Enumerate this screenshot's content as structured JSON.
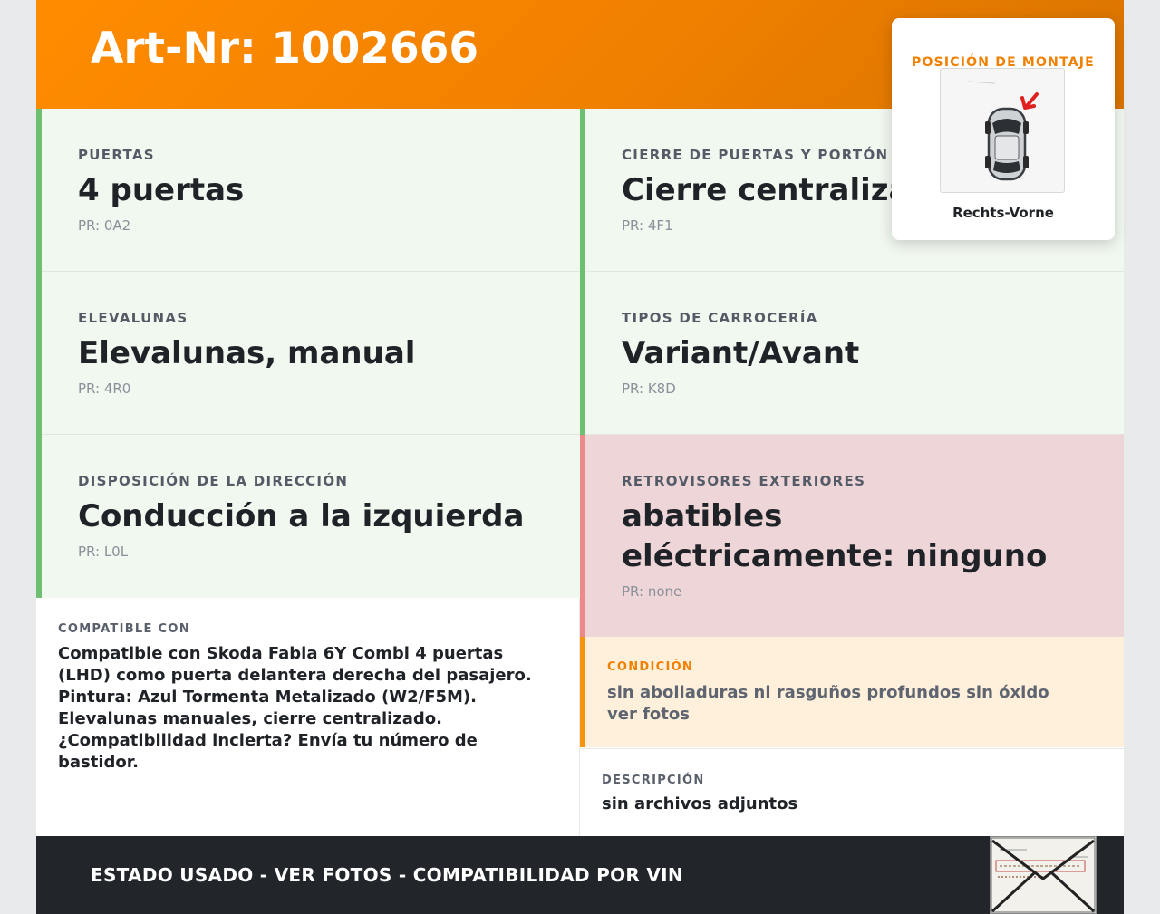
{
  "header": {
    "title": "Art-Nr: 1002666"
  },
  "specs": [
    {
      "label": "PUERTAS",
      "value": "4 puertas",
      "pr": "PR: 0A2",
      "status": "ok"
    },
    {
      "label": "CIERRE DE PUERTAS Y PORTÓN",
      "value": "Cierre centralizado",
      "pr": "PR: 4F1",
      "status": "ok"
    },
    {
      "label": "ELEVALUNAS",
      "value": "Elevalunas, manual",
      "pr": "PR: 4R0",
      "status": "ok"
    },
    {
      "label": "TIPOS DE CARROCERÍA",
      "value": "Variant/Avant",
      "pr": "PR: K8D",
      "status": "ok"
    },
    {
      "label": "DISPOSICIÓN DE LA DIRECCIÓN",
      "value": "Conducción a la izquierda",
      "pr": "PR: L0L",
      "status": "ok"
    },
    {
      "label": "RETROVISORES EXTERIORES",
      "value": "abatibles eléctricamente: ninguno",
      "pr": "PR: none",
      "status": "mismatch"
    }
  ],
  "compatible": {
    "label": "COMPATIBLE CON",
    "text": "Compatible con Skoda Fabia 6Y Combi 4 puertas (LHD) como puerta delantera derecha del pasajero. Pintura: Azul Tormenta Metalizado (W2/F5M). Elevalunas manuales, cierre centralizado. ¿Compatibilidad incierta? Envía tu número de bastidor."
  },
  "condition": {
    "label": "CONDICIÓN",
    "text": "sin abolladuras ni rasguños profundos sin óxido ver fotos"
  },
  "description": {
    "label": "DESCRIPCIÓN",
    "text": "sin archivos adjuntos"
  },
  "footer": {
    "text": "ESTADO USADO - VER FOTOS - COMPATIBILIDAD POR VIN"
  },
  "mounting": {
    "title": "POSICIÓN DE MONTAJE",
    "position": "Rechts-Vorne",
    "marker_color": "#e0201e"
  },
  "colors": {
    "brand_orange": "#f08000",
    "ok_green": "#6cc070",
    "ok_bg": "#f1f8f0",
    "mismatch_red": "#ec8a8a",
    "mismatch_bg": "#eed6d8",
    "condition_bg": "#fff0db",
    "footer_bg": "#22262b"
  }
}
